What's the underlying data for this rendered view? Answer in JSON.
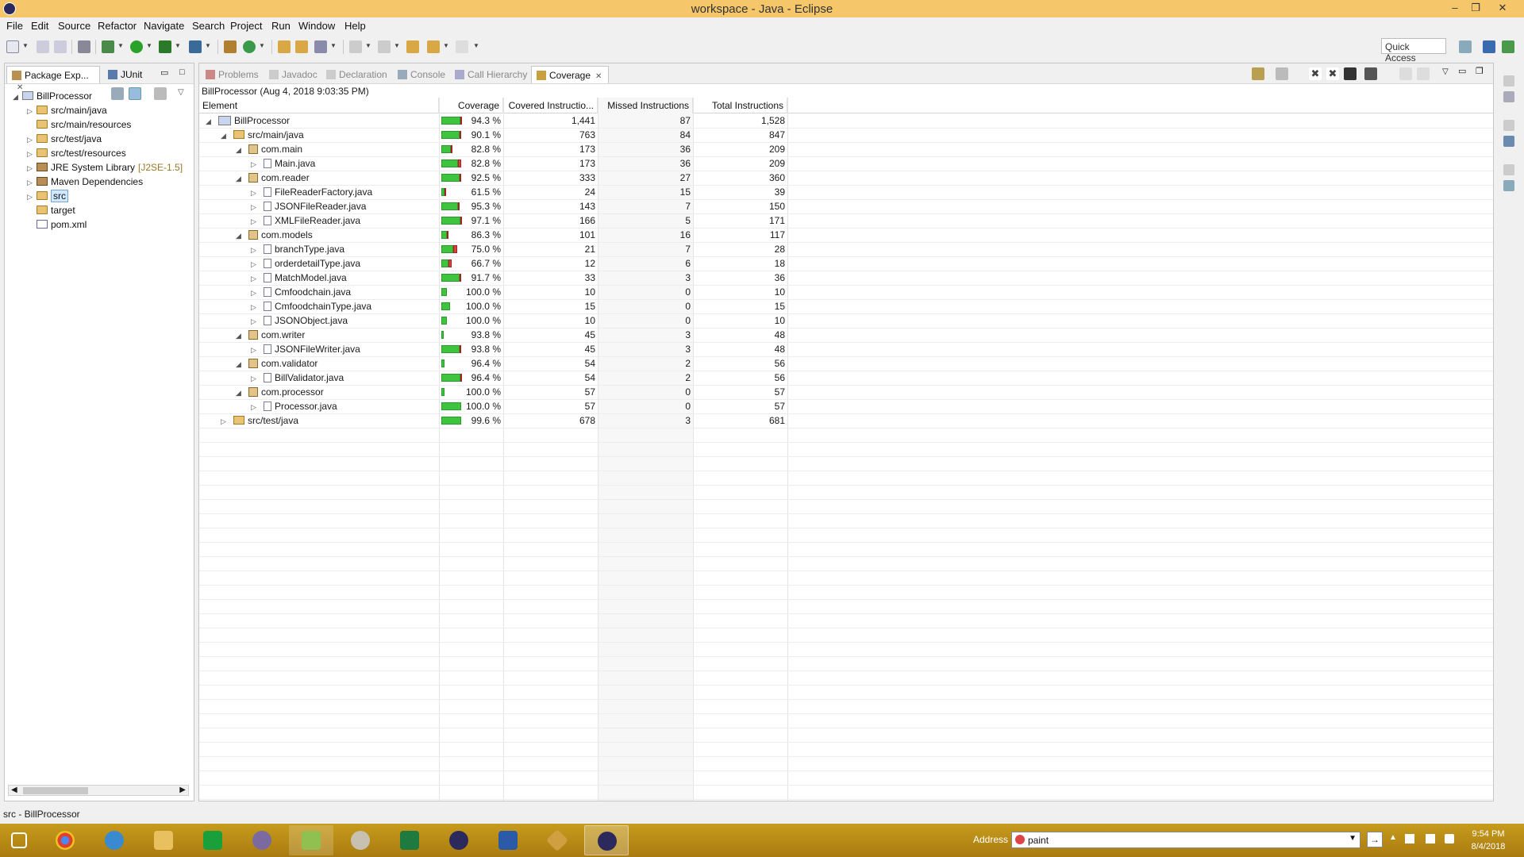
{
  "window": {
    "title": "workspace - Java - Eclipse",
    "minimize": "–",
    "restore": "❐",
    "close": "✕"
  },
  "menu": [
    "File",
    "Edit",
    "Source",
    "Refactor",
    "Navigate",
    "Search",
    "Project",
    "Run",
    "Window",
    "Help"
  ],
  "toolbar": {
    "quick_access": "Quick Access"
  },
  "left_panel": {
    "tabs": [
      {
        "label": "Package Exp...",
        "active": true
      },
      {
        "label": "JUnit",
        "active": false
      }
    ],
    "tree": [
      {
        "label": "BillProcessor",
        "depth": 0,
        "icon": "project",
        "expanded": true
      },
      {
        "label": "src/main/java",
        "depth": 1,
        "icon": "source-folder",
        "expanded": false
      },
      {
        "label": "src/main/resources",
        "depth": 1,
        "icon": "source-folder",
        "expanded": null
      },
      {
        "label": "src/test/java",
        "depth": 1,
        "icon": "source-folder",
        "expanded": false
      },
      {
        "label": "src/test/resources",
        "depth": 1,
        "icon": "source-folder",
        "expanded": false
      },
      {
        "label": "JRE System Library",
        "decor": "[J2SE-1.5]",
        "depth": 1,
        "icon": "library",
        "expanded": false
      },
      {
        "label": "Maven Dependencies",
        "depth": 1,
        "icon": "library",
        "expanded": false
      },
      {
        "label": "src",
        "depth": 1,
        "icon": "folder",
        "expanded": false,
        "selected": true
      },
      {
        "label": "target",
        "depth": 1,
        "icon": "folder",
        "expanded": null
      },
      {
        "label": "pom.xml",
        "depth": 1,
        "icon": "xml-file",
        "expanded": null
      }
    ]
  },
  "main_panel": {
    "tabs": [
      {
        "label": "Problems",
        "active": false
      },
      {
        "label": "Javadoc",
        "active": false
      },
      {
        "label": "Declaration",
        "active": false
      },
      {
        "label": "Console",
        "active": false
      },
      {
        "label": "Call Hierarchy",
        "active": false
      },
      {
        "label": "Coverage",
        "active": true
      }
    ],
    "session_title": "BillProcessor (Aug 4, 2018 9:03:35 PM)",
    "columns": [
      "Element",
      "Coverage",
      "Covered Instructio...",
      "Missed Instructions",
      "Total Instructions"
    ],
    "rows": [
      {
        "element": "BillProcessor",
        "depth": 0,
        "icon": "project",
        "twist": "expanded",
        "coverage": "94.3 %",
        "covered": "1,441",
        "missed": "87",
        "total": "1,528",
        "bar_g": 0.943,
        "bar_len": 1.0
      },
      {
        "element": "src/main/java",
        "depth": 1,
        "icon": "src",
        "twist": "expanded",
        "coverage": "90.1 %",
        "covered": "763",
        "missed": "84",
        "total": "847",
        "bar_g": 0.901,
        "bar_len": 1.0
      },
      {
        "element": "com.main",
        "depth": 2,
        "icon": "pkg",
        "twist": "expanded",
        "coverage": "82.8 %",
        "covered": "173",
        "missed": "36",
        "total": "209",
        "bar_g": 0.828,
        "bar_len": 0.58
      },
      {
        "element": "Main.java",
        "depth": 3,
        "icon": "java",
        "twist": "collapsed",
        "coverage": "82.8 %",
        "covered": "173",
        "missed": "36",
        "total": "209",
        "bar_g": 0.828,
        "bar_len": 1.0
      },
      {
        "element": "com.reader",
        "depth": 2,
        "icon": "pkg",
        "twist": "expanded",
        "coverage": "92.5 %",
        "covered": "333",
        "missed": "27",
        "total": "360",
        "bar_g": 0.925,
        "bar_len": 1.0
      },
      {
        "element": "FileReaderFactory.java",
        "depth": 3,
        "icon": "java",
        "twist": "collapsed",
        "coverage": "61.5 %",
        "covered": "24",
        "missed": "15",
        "total": "39",
        "bar_g": 0.615,
        "bar_len": 0.23
      },
      {
        "element": "JSONFileReader.java",
        "depth": 3,
        "icon": "java",
        "twist": "collapsed",
        "coverage": "95.3 %",
        "covered": "143",
        "missed": "7",
        "total": "150",
        "bar_g": 0.953,
        "bar_len": 0.88
      },
      {
        "element": "XMLFileReader.java",
        "depth": 3,
        "icon": "java",
        "twist": "collapsed",
        "coverage": "97.1 %",
        "covered": "166",
        "missed": "5",
        "total": "171",
        "bar_g": 0.971,
        "bar_len": 1.0
      },
      {
        "element": "com.models",
        "depth": 2,
        "icon": "pkg",
        "twist": "expanded",
        "coverage": "86.3 %",
        "covered": "101",
        "missed": "16",
        "total": "117",
        "bar_g": 0.863,
        "bar_len": 0.33
      },
      {
        "element": "branchType.java",
        "depth": 3,
        "icon": "java",
        "twist": "collapsed",
        "coverage": "75.0 %",
        "covered": "21",
        "missed": "7",
        "total": "28",
        "bar_g": 0.75,
        "bar_len": 0.78
      },
      {
        "element": "orderdetailType.java",
        "depth": 3,
        "icon": "java",
        "twist": "collapsed",
        "coverage": "66.7 %",
        "covered": "12",
        "missed": "6",
        "total": "18",
        "bar_g": 0.667,
        "bar_len": 0.5
      },
      {
        "element": "MatchModel.java",
        "depth": 3,
        "icon": "java",
        "twist": "collapsed",
        "coverage": "91.7 %",
        "covered": "33",
        "missed": "3",
        "total": "36",
        "bar_g": 0.917,
        "bar_len": 1.0
      },
      {
        "element": "Cmfoodchain.java",
        "depth": 3,
        "icon": "java",
        "twist": "collapsed",
        "coverage": "100.0 %",
        "covered": "10",
        "missed": "0",
        "total": "10",
        "bar_g": 1.0,
        "bar_len": 0.28
      },
      {
        "element": "CmfoodchainType.java",
        "depth": 3,
        "icon": "java",
        "twist": "collapsed",
        "coverage": "100.0 %",
        "covered": "15",
        "missed": "0",
        "total": "15",
        "bar_g": 1.0,
        "bar_len": 0.42
      },
      {
        "element": "JSONObject.java",
        "depth": 3,
        "icon": "java",
        "twist": "collapsed",
        "coverage": "100.0 %",
        "covered": "10",
        "missed": "0",
        "total": "10",
        "bar_g": 1.0,
        "bar_len": 0.28
      },
      {
        "element": "com.writer",
        "depth": 2,
        "icon": "pkg",
        "twist": "expanded",
        "coverage": "93.8 %",
        "covered": "45",
        "missed": "3",
        "total": "48",
        "bar_g": 0.938,
        "bar_len": 0.13
      },
      {
        "element": "JSONFileWriter.java",
        "depth": 3,
        "icon": "java",
        "twist": "collapsed",
        "coverage": "93.8 %",
        "covered": "45",
        "missed": "3",
        "total": "48",
        "bar_g": 0.938,
        "bar_len": 1.0
      },
      {
        "element": "com.validator",
        "depth": 2,
        "icon": "pkg",
        "twist": "expanded",
        "coverage": "96.4 %",
        "covered": "54",
        "missed": "2",
        "total": "56",
        "bar_g": 0.964,
        "bar_len": 0.16
      },
      {
        "element": "BillValidator.java",
        "depth": 3,
        "icon": "java",
        "twist": "collapsed",
        "coverage": "96.4 %",
        "covered": "54",
        "missed": "2",
        "total": "56",
        "bar_g": 0.964,
        "bar_len": 1.0
      },
      {
        "element": "com.processor",
        "depth": 2,
        "icon": "pkg",
        "twist": "expanded",
        "coverage": "100.0 %",
        "covered": "57",
        "missed": "0",
        "total": "57",
        "bar_g": 1.0,
        "bar_len": 0.16
      },
      {
        "element": "Processor.java",
        "depth": 3,
        "icon": "java",
        "twist": "collapsed",
        "coverage": "100.0 %",
        "covered": "57",
        "missed": "0",
        "total": "57",
        "bar_g": 1.0,
        "bar_len": 1.0
      },
      {
        "element": "src/test/java",
        "depth": 1,
        "icon": "src",
        "twist": "collapsed",
        "coverage": "99.6 %",
        "covered": "678",
        "missed": "3",
        "total": "681",
        "bar_g": 0.996,
        "bar_len": 1.0
      }
    ]
  },
  "status": {
    "text": "src - BillProcessor"
  },
  "taskbar": {
    "address_label": "Address",
    "address_value": "paint",
    "time": "9:54 PM",
    "date": "8/4/2018"
  }
}
